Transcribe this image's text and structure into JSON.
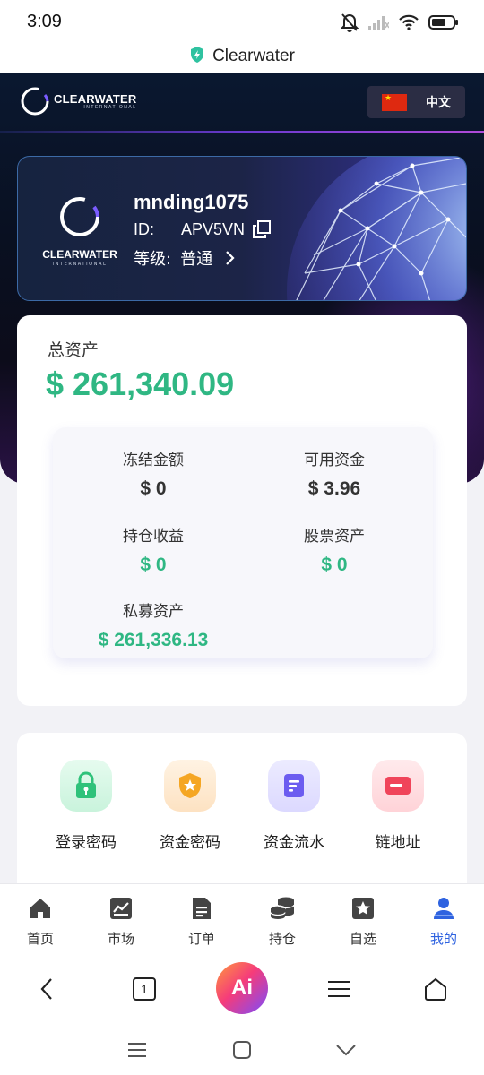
{
  "status_bar": {
    "time": "3:09"
  },
  "url_bar": {
    "title": "Clearwater"
  },
  "header": {
    "logo_text": "CLEARWATER",
    "logo_sub": "INTERNATIONAL",
    "language": "中文"
  },
  "profile": {
    "username": "mnding1075",
    "id_label": "ID:",
    "id_value": "APV5VN",
    "level_label": "等级:",
    "level_value": "普通",
    "logo_text": "CLEARWATER",
    "logo_sub": "INTERNATIONAL"
  },
  "assets": {
    "title": "总资产",
    "total": "$ 261,340.09",
    "stats": [
      {
        "label": "冻结金额",
        "value": "$ 0"
      },
      {
        "label": "可用资金",
        "value": "$ 3.96"
      },
      {
        "label": "持仓收益",
        "value": "$ 0"
      },
      {
        "label": "股票资产",
        "value": "$ 0"
      },
      {
        "label": "私募资产",
        "value": "$ 261,336.13"
      }
    ]
  },
  "actions": [
    {
      "label": "登录密码",
      "icon": "lock-icon"
    },
    {
      "label": "资金密码",
      "icon": "shield-star-icon"
    },
    {
      "label": "资金流水",
      "icon": "document-list-icon"
    },
    {
      "label": "链地址",
      "icon": "card-icon"
    }
  ],
  "bottom_nav": [
    {
      "label": "首页",
      "icon": "home-icon"
    },
    {
      "label": "市场",
      "icon": "chart-icon"
    },
    {
      "label": "订单",
      "icon": "document-icon"
    },
    {
      "label": "持仓",
      "icon": "coins-icon"
    },
    {
      "label": "自选",
      "icon": "star-icon"
    },
    {
      "label": "我的",
      "icon": "user-icon",
      "active": true
    }
  ],
  "browser": {
    "tab_count": "1",
    "ai_label": "Ai"
  },
  "colors": {
    "accent_green": "#2fb783",
    "active_blue": "#2f63e0",
    "lock_green": "#2fc27a",
    "shield_orange": "#f5a623",
    "doc_purple": "#6b5cf0",
    "card_red": "#f0445a"
  }
}
